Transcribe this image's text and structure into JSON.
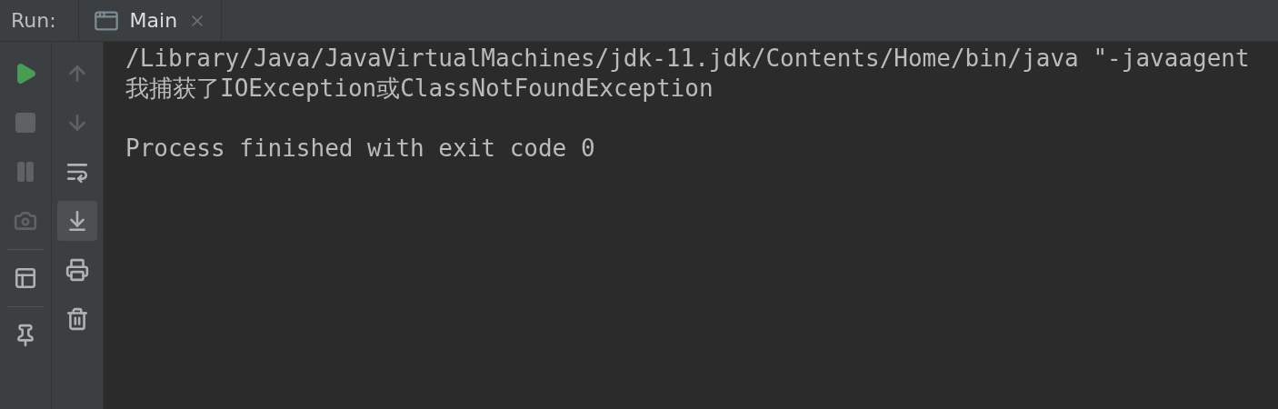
{
  "run_bar": {
    "label": "Run:",
    "tab": {
      "title": "Main",
      "selected": true
    }
  },
  "left_tools": [
    {
      "kind": "run",
      "disabled": false
    },
    {
      "kind": "stop",
      "disabled": true
    },
    {
      "kind": "pause",
      "disabled": true
    },
    {
      "kind": "snapshot",
      "disabled": true
    },
    {
      "kind": "layout",
      "disabled": false
    },
    {
      "kind": "pin",
      "disabled": false
    }
  ],
  "right_tools": [
    {
      "kind": "up",
      "disabled": true,
      "on": false
    },
    {
      "kind": "down",
      "disabled": true,
      "on": false
    },
    {
      "kind": "wrap",
      "disabled": false,
      "on": false
    },
    {
      "kind": "scroll_end",
      "disabled": false,
      "on": true
    },
    {
      "kind": "print",
      "disabled": false,
      "on": false
    },
    {
      "kind": "clear",
      "disabled": false,
      "on": false
    }
  ],
  "console": {
    "output_lines": [
      "/Library/Java/JavaVirtualMachines/jdk-11.jdk/Contents/Home/bin/java \"-javaagent",
      "我捕获了IOException或ClassNotFoundException"
    ],
    "exit_message": "Process finished with exit code 0"
  }
}
